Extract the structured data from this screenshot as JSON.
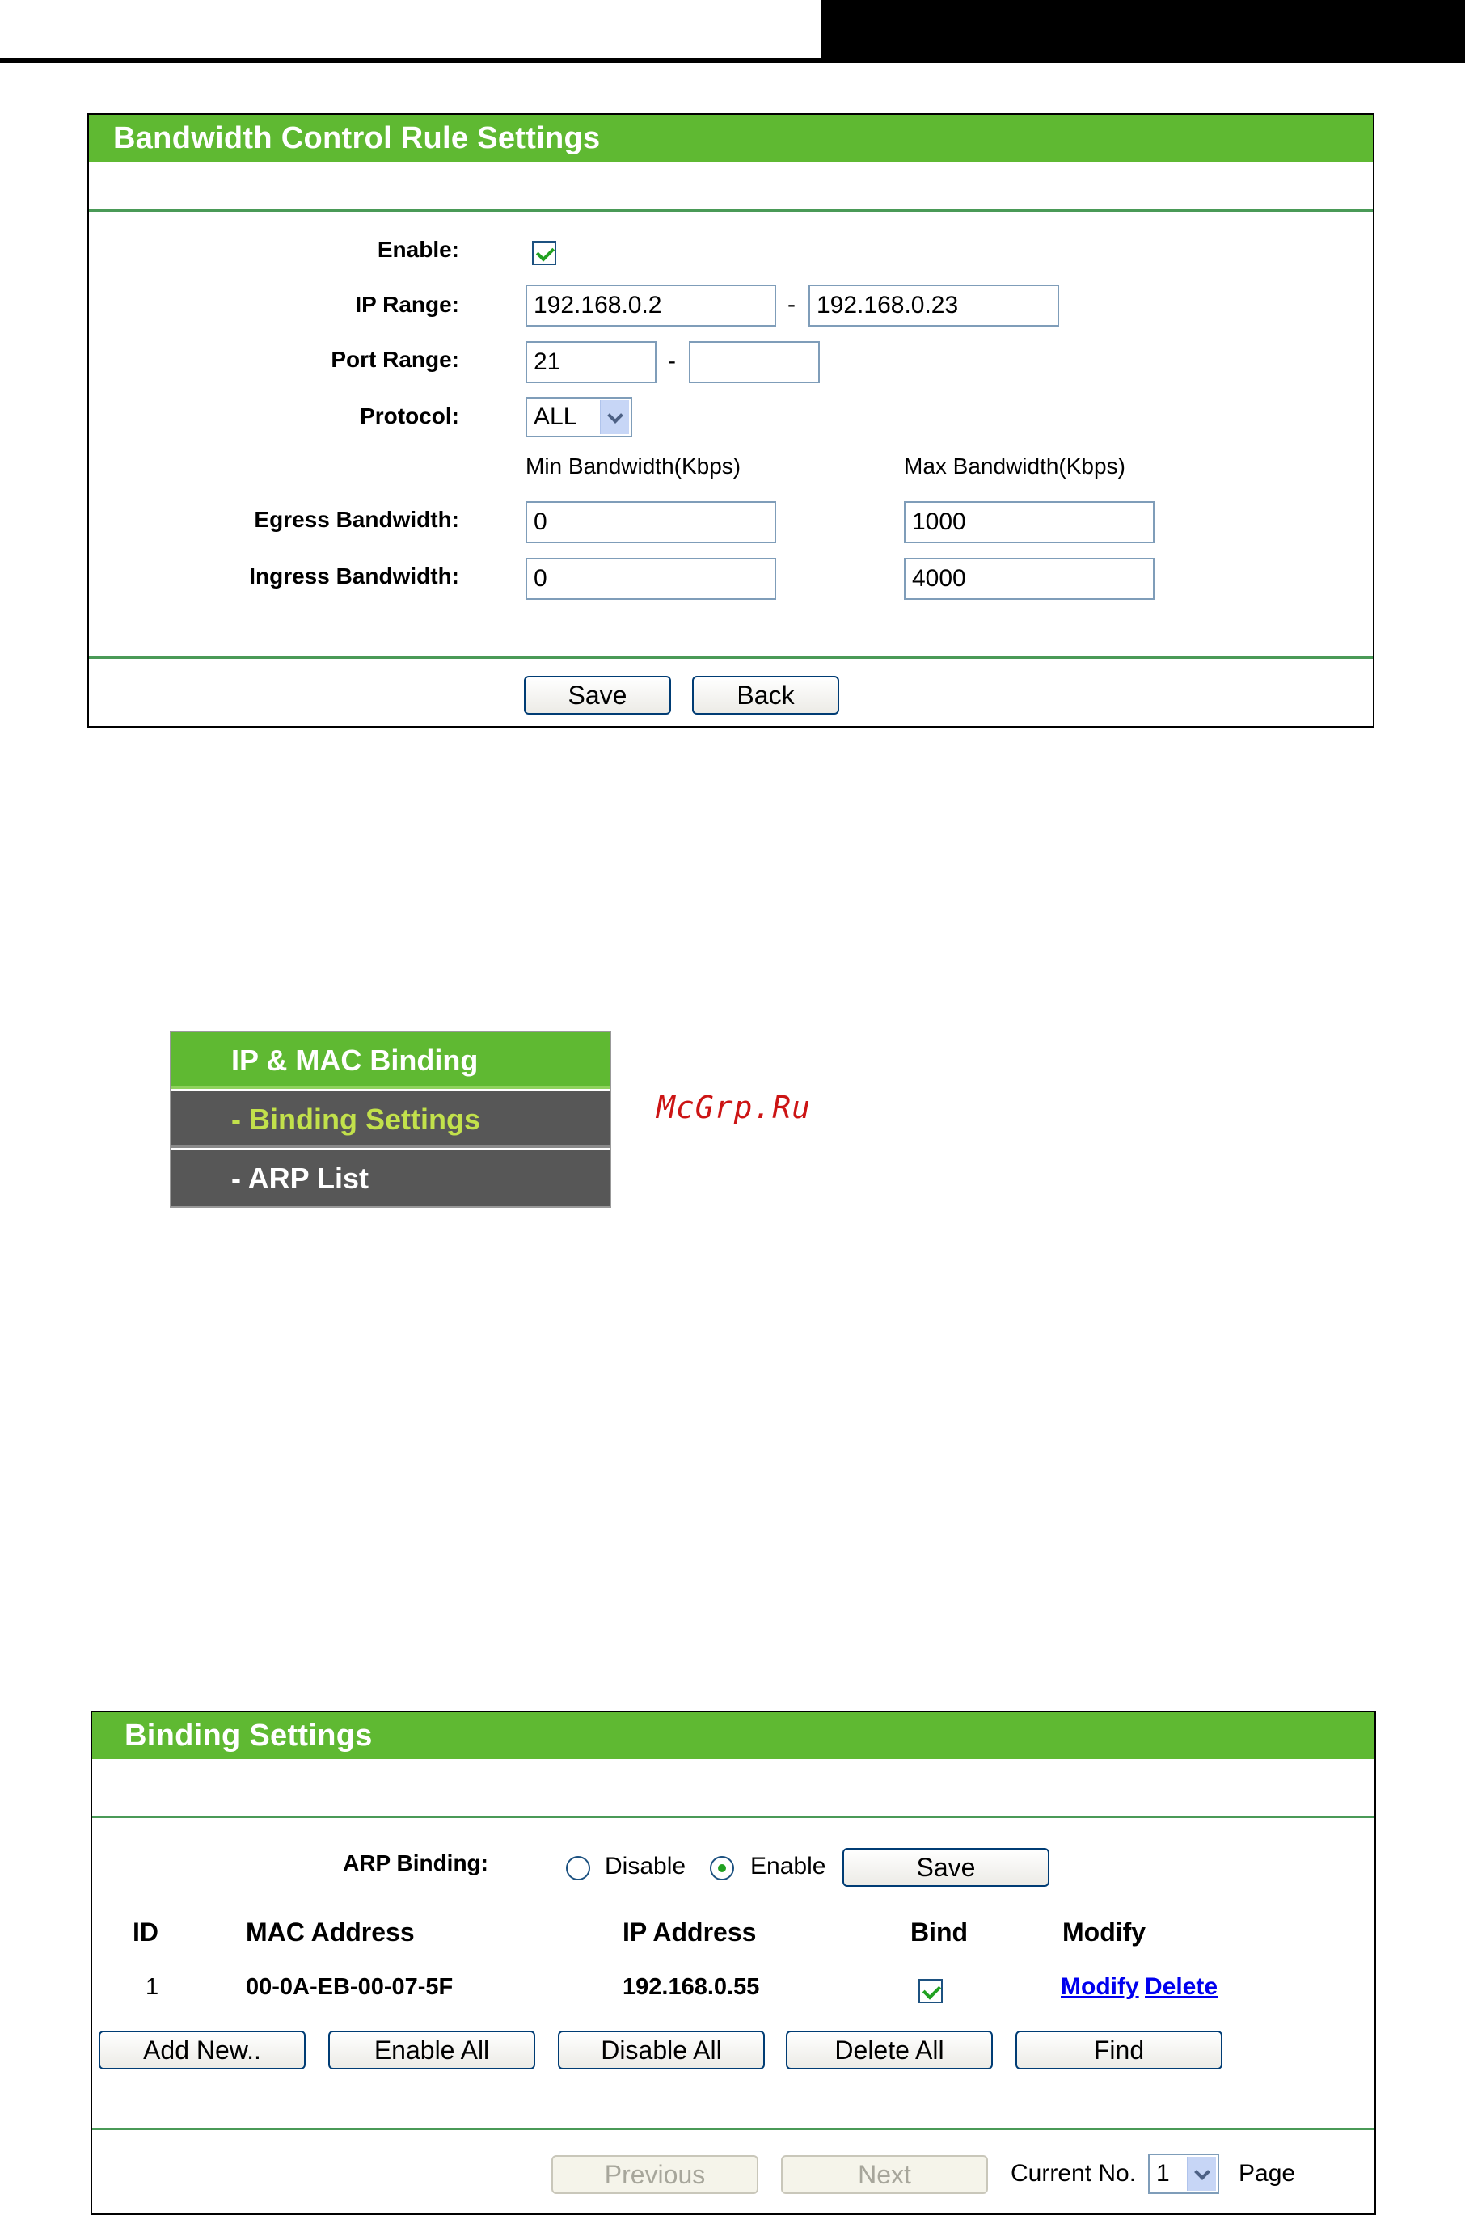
{
  "bandwidth_panel": {
    "title": "Bandwidth Control Rule Settings",
    "enable_label": "Enable:",
    "enable_checked": true,
    "ip_range_label": "IP Range:",
    "ip_start": "192.168.0.2",
    "ip_end": "192.168.0.23",
    "port_range_label": "Port Range:",
    "port_start": "21",
    "port_end": "",
    "protocol_label": "Protocol:",
    "protocol_value": "ALL",
    "min_header": "Min Bandwidth(Kbps)",
    "max_header": "Max Bandwidth(Kbps)",
    "egress_label": "Egress Bandwidth:",
    "egress_min": "0",
    "egress_max": "1000",
    "ingress_label": "Ingress Bandwidth:",
    "ingress_min": "0",
    "ingress_max": "4000",
    "range_separator": "-",
    "save_label": "Save",
    "back_label": "Back"
  },
  "menu": {
    "title": "IP & MAC Binding",
    "items": [
      {
        "label": "- Binding Settings",
        "active": true
      },
      {
        "label": "- ARP List",
        "active": false
      }
    ]
  },
  "watermark": "McGrp.Ru",
  "binding_panel": {
    "title": "Binding Settings",
    "arp_binding_label": "ARP Binding:",
    "disable_label": "Disable",
    "enable_label": "Enable",
    "arp_state": "Enable",
    "save_label": "Save",
    "columns": [
      "ID",
      "MAC Address",
      "IP Address",
      "Bind",
      "Modify"
    ],
    "rows": [
      {
        "id": "1",
        "mac": "00-0A-EB-00-07-5F",
        "ip": "192.168.0.55",
        "bind": true,
        "modify": "Modify",
        "delete": "Delete"
      }
    ],
    "buttons": [
      "Add New..",
      "Enable All",
      "Disable All",
      "Delete All",
      "Find"
    ],
    "previous_label": "Previous",
    "next_label": "Next",
    "current_no_label": "Current No.",
    "current_page": "1",
    "page_label": "Page"
  },
  "colors": {
    "header_green": "#5fb932",
    "menu_dark": "#575757",
    "menu_active_text": "#c2e14b",
    "link_blue": "#0000ee"
  }
}
